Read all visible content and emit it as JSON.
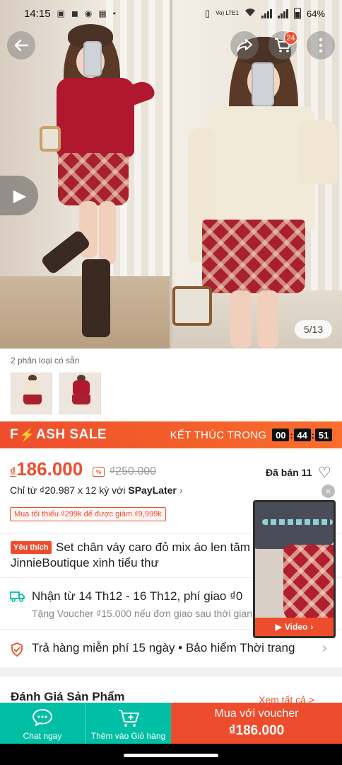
{
  "status_bar": {
    "time": "14:15",
    "battery": "64%",
    "network": "Vo) LTE1"
  },
  "gallery": {
    "page_counter": "5/13",
    "cart_count": "24"
  },
  "variants": {
    "label": "2 phân loại có sẵn"
  },
  "flash_sale": {
    "title_part1": "F",
    "title_part2": "ASH SALE",
    "ends_label": "KẾT THÚC TRONG",
    "hours": "00",
    "minutes": "44",
    "seconds": "51"
  },
  "price": {
    "currency": "₫",
    "current": "186.000",
    "old": "₫250.000",
    "sold": "Đã bán 11",
    "installment_prefix": "Chỉ từ ₫20.987 x 12 kỳ với ",
    "installment_brand": "SPayLater",
    "min_order_tag": "Mua tối thiểu ₫299k để được giảm ₫9,999k"
  },
  "product": {
    "badge": "Yêu thích",
    "title_line1": "Set chân váy caro đỏ mix áo len tăm",
    "title_line2": "JinnieBoutique xinh tiểu thư"
  },
  "shipping": {
    "main": "Nhận từ 14 Th12 - 16 Th12, phí giao ₫0",
    "sub": "Tặng Voucher ₫15.000 nếu đơn giao sau thời gian trên."
  },
  "returns": {
    "text": "Trả hàng miễn phí 15 ngày  •  Bảo hiểm Thời trang"
  },
  "reviews": {
    "title": "Đánh Giá Sản Phẩm",
    "link": "Xem tất cả >"
  },
  "mini_video": {
    "label": "Video",
    "close": "×"
  },
  "bottom_bar": {
    "chat": "Chat ngay",
    "add_cart": "Thêm vào Giỏ hàng",
    "buy_label": "Mua với voucher",
    "buy_price": "₫186.000"
  },
  "colors": {
    "brand": "#ee4d2d",
    "teal": "#00bfa5"
  },
  "icons": [
    "back-arrow-icon",
    "share-icon",
    "cart-icon",
    "more-icon",
    "play-icon",
    "heart-icon",
    "truck-icon",
    "shield-icon",
    "chat-icon",
    "add-cart-icon",
    "bolt-icon"
  ]
}
